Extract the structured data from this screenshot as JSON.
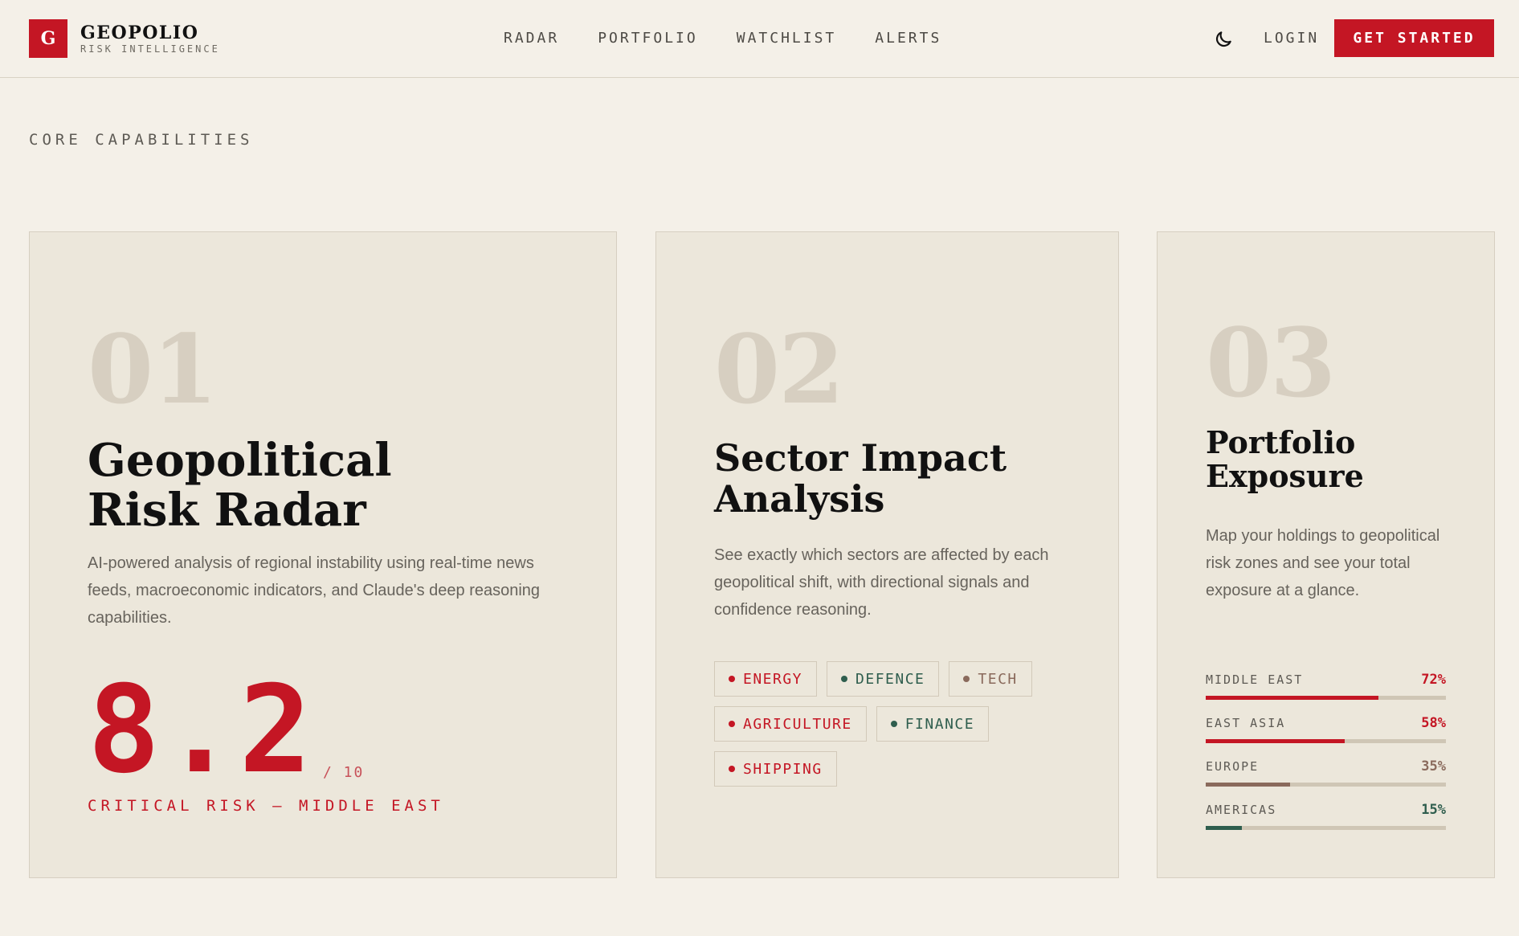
{
  "header": {
    "logo_letter": "G",
    "brand_name": "GEOPOLIO",
    "brand_sub": "RISK INTELLIGENCE",
    "nav": [
      {
        "label": "RADAR"
      },
      {
        "label": "PORTFOLIO"
      },
      {
        "label": "WATCHLIST"
      },
      {
        "label": "ALERTS"
      }
    ],
    "theme_icon": "moon-icon",
    "login_label": "LOGIN",
    "cta_label": "GET STARTED"
  },
  "section_label": "CORE CAPABILITIES",
  "cards": [
    {
      "number": "01",
      "title": "Geopolitical Risk Radar",
      "description": "AI-powered analysis of regional instability using real-time news feeds, macroeconomic indicators, and Claude's deep reasoning capabilities.",
      "score": "8.2",
      "score_scale": "/ 10",
      "risk_label": "CRITICAL RISK — MIDDLE EAST"
    },
    {
      "number": "02",
      "title": "Sector Impact Analysis",
      "description": "See exactly which sectors are affected by each geopolitical shift, with directional signals and confidence reasoning.",
      "tags": [
        {
          "label": "ENERGY",
          "tone": "red"
        },
        {
          "label": "DEFENCE",
          "tone": "green"
        },
        {
          "label": "TECH",
          "tone": "brown"
        },
        {
          "label": "AGRICULTURE",
          "tone": "red"
        },
        {
          "label": "FINANCE",
          "tone": "green"
        },
        {
          "label": "SHIPPING",
          "tone": "red"
        }
      ]
    },
    {
      "number": "03",
      "title": "Portfolio Exposure",
      "description": "Map your holdings to geopolitical risk zones and see your total exposure at a glance.",
      "exposure": [
        {
          "region": "MIDDLE EAST",
          "pct": "72%",
          "value": 72,
          "tone": "red"
        },
        {
          "region": "EAST ASIA",
          "pct": "58%",
          "value": 58,
          "tone": "red"
        },
        {
          "region": "EUROPE",
          "pct": "35%",
          "value": 35,
          "tone": "brown"
        },
        {
          "region": "AMERICAS",
          "pct": "15%",
          "value": 15,
          "tone": "green"
        }
      ]
    }
  ],
  "colors": {
    "accent": "#c41624",
    "background": "#f4f0e8",
    "card": "#ece7db",
    "green": "#2f5e4e",
    "brown": "#8a6a5c"
  }
}
